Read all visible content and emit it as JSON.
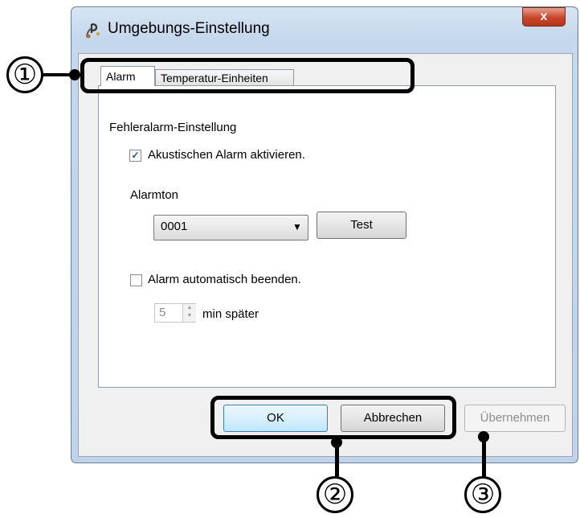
{
  "window": {
    "title": "Umgebungs-Einstellung",
    "close_glyph": "x"
  },
  "tabs": [
    {
      "label": "Alarm",
      "selected": true
    },
    {
      "label": "Temperatur-Einheiten",
      "selected": false
    }
  ],
  "alarm": {
    "section_label": "Fehleralarm-Einstellung",
    "acoustic_checkbox": {
      "label": "Akustischen Alarm aktivieren.",
      "checked": true,
      "glyph": "✓"
    },
    "tone_label": "Alarmton",
    "tone_select": {
      "value": "0001",
      "arrow": "▼"
    },
    "test_button": "Test",
    "auto_stop_checkbox": {
      "label": "Alarm automatisch beenden.",
      "checked": false
    },
    "minutes": {
      "value": "5",
      "suffix": "min später",
      "up": "▲",
      "down": "▼"
    }
  },
  "buttons": {
    "ok": "OK",
    "cancel": "Abbrechen",
    "apply": "Übernehmen"
  },
  "callouts": [
    "①",
    "②",
    "③"
  ],
  "colors": {
    "frame": "#c4d7ec",
    "close_button": "#c8452b",
    "ok_border": "#3c7fb1",
    "checkbox_mark": "#2a4e9e"
  }
}
